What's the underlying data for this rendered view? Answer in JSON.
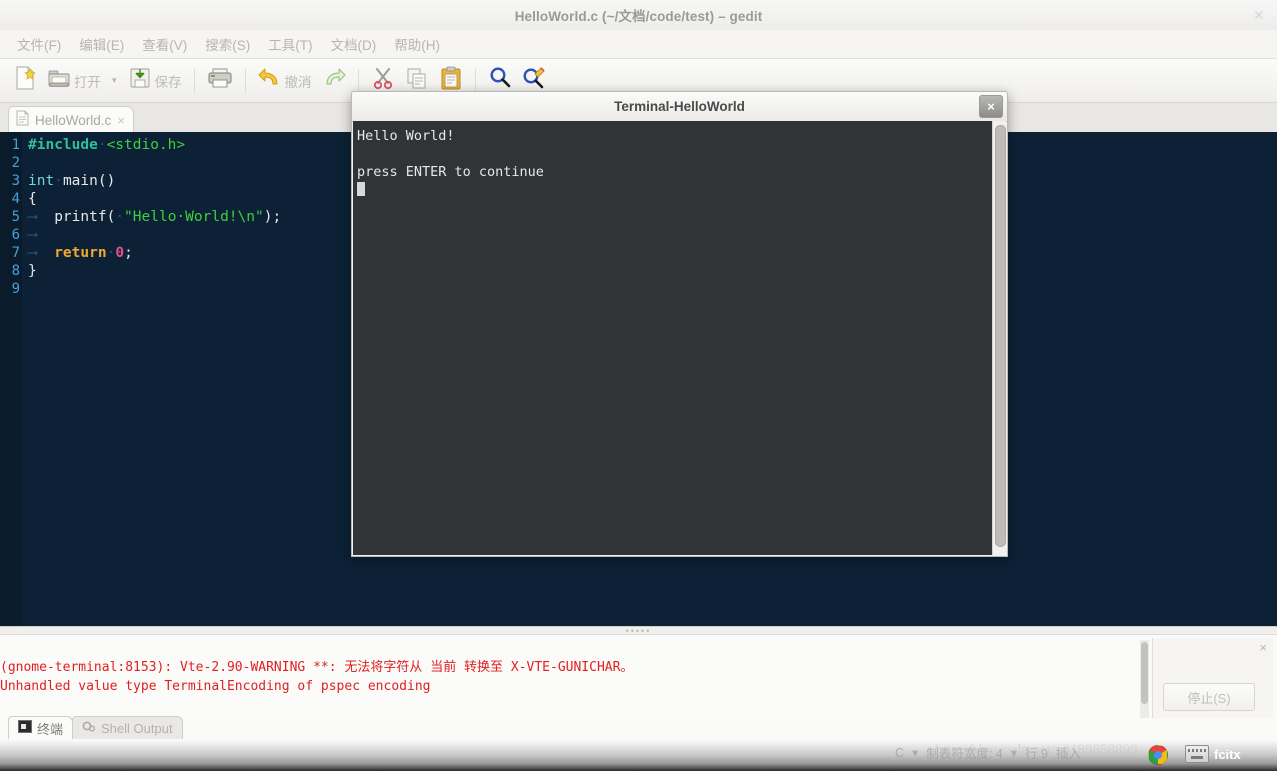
{
  "window": {
    "title": "HelloWorld.c (~/文档/code/test) – gedit",
    "close_icon": "close-icon"
  },
  "menubar": {
    "items": [
      {
        "label": "文件(F)"
      },
      {
        "label": "编辑(E)"
      },
      {
        "label": "查看(V)"
      },
      {
        "label": "搜索(S)"
      },
      {
        "label": "工具(T)"
      },
      {
        "label": "文档(D)"
      },
      {
        "label": "帮助(H)"
      }
    ]
  },
  "toolbar": {
    "new_label": "",
    "open_label": "打开",
    "open_caret": "▾",
    "save_label": "保存",
    "print_label": "",
    "undo_label": "撤消",
    "redo_label": "",
    "cut_label": "",
    "copy_label": "",
    "paste_label": "",
    "find_label": "",
    "replace_label": ""
  },
  "tabs": {
    "document": {
      "label": "HelloWorld.c",
      "close": "×"
    }
  },
  "editor": {
    "lines": [
      {
        "n": "1",
        "tokens": [
          {
            "t": "#include",
            "c": "c-pre"
          },
          {
            "t": "·",
            "c": "dot"
          },
          {
            "t": "<stdio.h>",
            "c": "c-hdr"
          }
        ]
      },
      {
        "n": "2",
        "tokens": []
      },
      {
        "n": "3",
        "tokens": [
          {
            "t": "int",
            "c": "c-type"
          },
          {
            "t": "·",
            "c": "dot"
          },
          {
            "t": "main()",
            "c": "c-plain"
          }
        ]
      },
      {
        "n": "4",
        "tokens": [
          {
            "t": "{",
            "c": "c-plain"
          }
        ]
      },
      {
        "n": "5",
        "tokens": [
          {
            "t": "⟶  ",
            "c": "tabarrow"
          },
          {
            "t": "printf(",
            "c": "c-plain"
          },
          {
            "t": "·",
            "c": "dot"
          },
          {
            "t": "\"Hello·World!\\n\"",
            "c": "c-str"
          },
          {
            "t": ");",
            "c": "c-plain"
          }
        ]
      },
      {
        "n": "6",
        "tokens": [
          {
            "t": "⟶  ",
            "c": "tabarrow"
          }
        ]
      },
      {
        "n": "7",
        "tokens": [
          {
            "t": "⟶  ",
            "c": "tabarrow"
          },
          {
            "t": "return",
            "c": "c-kw"
          },
          {
            "t": "·",
            "c": "dot"
          },
          {
            "t": "0",
            "c": "c-num"
          },
          {
            "t": ";",
            "c": "c-plain"
          }
        ]
      },
      {
        "n": "8",
        "tokens": [
          {
            "t": "}",
            "c": "c-plain"
          }
        ]
      },
      {
        "n": "9",
        "tokens": []
      }
    ]
  },
  "terminal": {
    "title": "Terminal-HelloWorld",
    "close": "×",
    "output": "Hello World!\n\npress ENTER to continue\n"
  },
  "bottom_panel": {
    "shell_output": "(gnome-terminal:8153): Vte-2.90-WARNING **: 无法将字符从 当前 转换至 X-VTE-GUNICHAR。\nUnhandled value type TerminalEncoding of pspec encoding",
    "close": "×",
    "stop_button": "停止(S)",
    "tabs": [
      {
        "label": "终端",
        "icon": "terminal-icon",
        "active": true
      },
      {
        "label": "Shell Output",
        "icon": "gears-icon",
        "active": false
      }
    ]
  },
  "statusbar": {
    "left_text": "",
    "tab_width": "制表符宽度: 4",
    "position": "行 9",
    "caret_c": "C",
    "watermark": "http://blog.csdn.net/u0189858899",
    "fcitx_label": "fcitx",
    "insert_mode": "插入"
  },
  "colors": {
    "editor_bg": "#0c2135",
    "gutter_bg": "#0a1c2c",
    "terminal_bg": "#313436",
    "error_red": "#e02020",
    "line_number": "#4a9ed8"
  }
}
